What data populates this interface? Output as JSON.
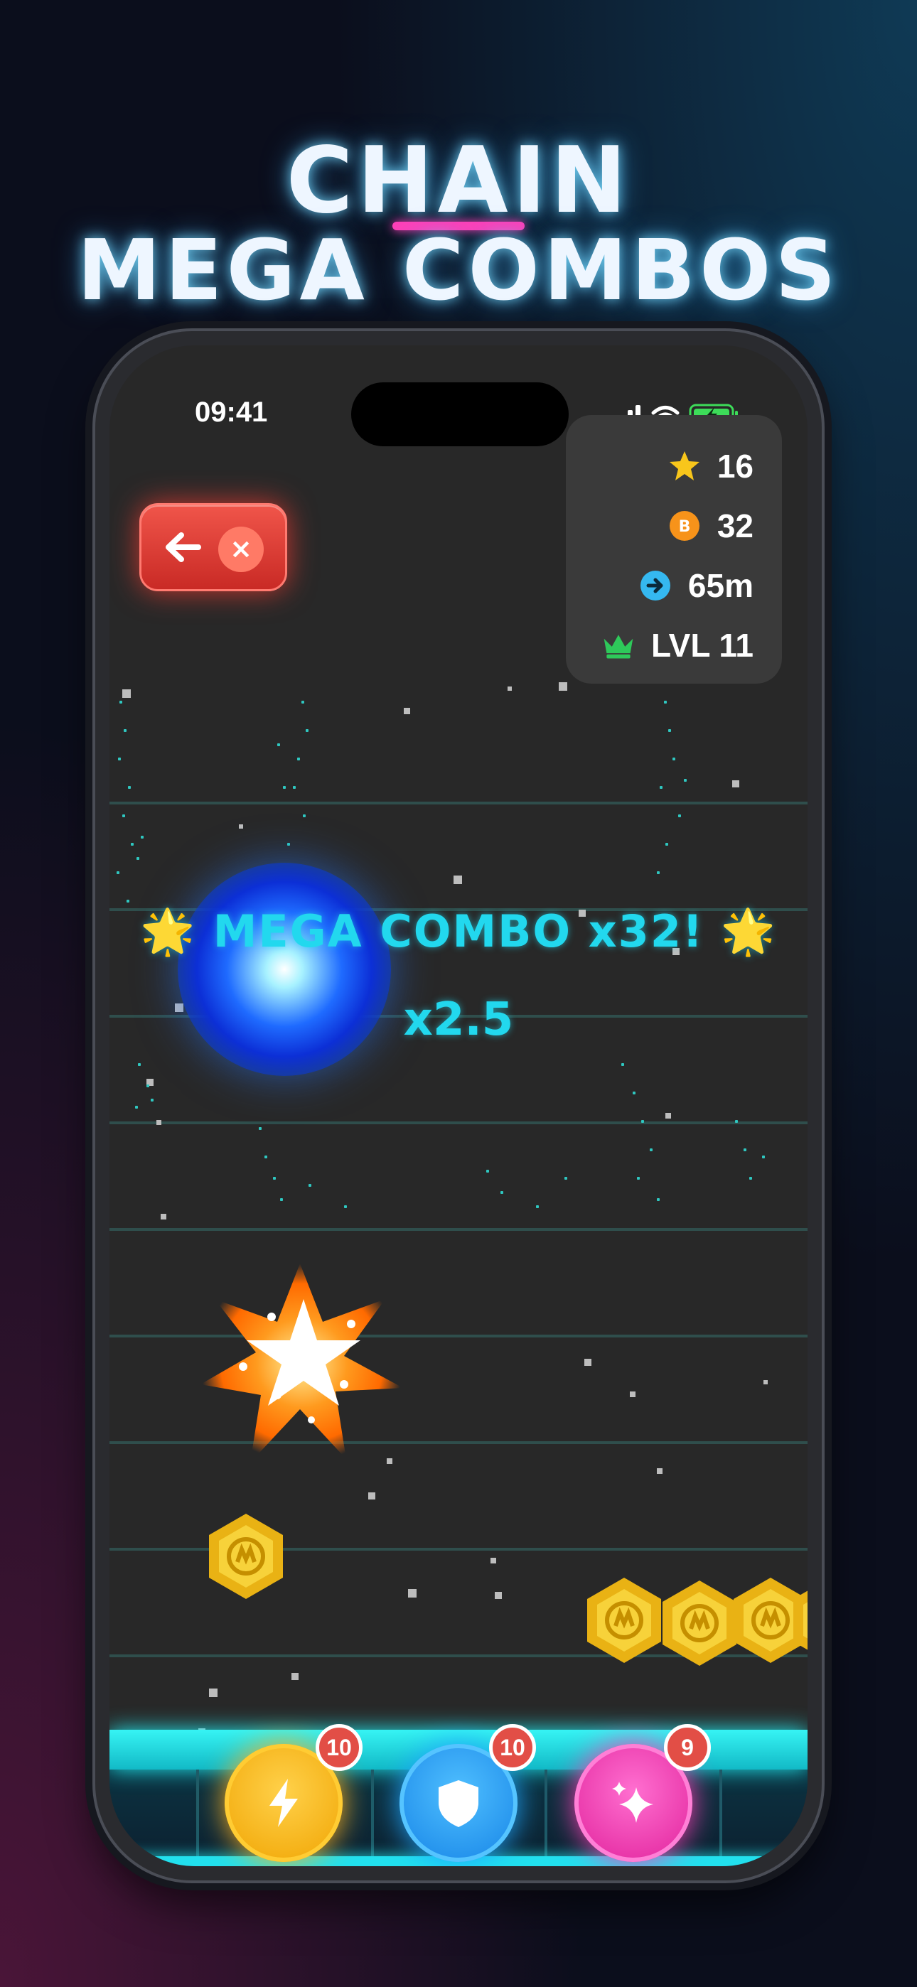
{
  "headline": {
    "line1": "CHAIN",
    "line2": "MEGA COMBOS",
    "underline_color": "#ff3fb8"
  },
  "status_bar": {
    "time": "09:41"
  },
  "back_button": {
    "close_glyph": "×"
  },
  "stats": {
    "stars": "16",
    "coins": "32",
    "distance": "65m",
    "level": "LVL 11"
  },
  "combo": {
    "text": "🌟 MEGA COMBO x32! 🌟",
    "multiplier": "x2.5",
    "color": "#22d8ee"
  },
  "powerups": [
    {
      "name": "lightning",
      "icon": "lightning-icon",
      "count": "10",
      "color": "#ffb21f"
    },
    {
      "name": "shield",
      "icon": "shield-icon",
      "count": "10",
      "color": "#1fa6ff"
    },
    {
      "name": "sparkle",
      "icon": "sparkle-icon",
      "count": "9",
      "color": "#ff3fb8"
    }
  ],
  "colors": {
    "accent_cyan": "#22e8ee",
    "gold": "#f3c21a",
    "danger": "#e24e46"
  }
}
